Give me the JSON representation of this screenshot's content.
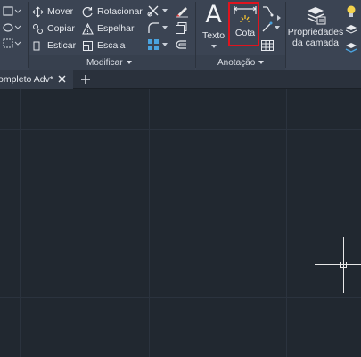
{
  "ribbon": {
    "modificar": {
      "title": "Modificar",
      "tools": {
        "mover": "Mover",
        "rotacionar": "Rotacionar",
        "copiar": "Copiar",
        "espelhar": "Espelhar",
        "esticar": "Esticar",
        "escala": "Escala"
      }
    },
    "anotacao": {
      "title": "Anotação",
      "texto": "Texto",
      "cota": "Cota"
    },
    "camadas": {
      "propriedades_line1": "Propriedades",
      "propriedades_line2": "da camada"
    }
  },
  "tabs": {
    "document": "ompleto Adv*"
  },
  "colors": {
    "ribbon_bg": "#3b4453",
    "canvas_bg": "#212830",
    "highlight": "#e0141e"
  }
}
